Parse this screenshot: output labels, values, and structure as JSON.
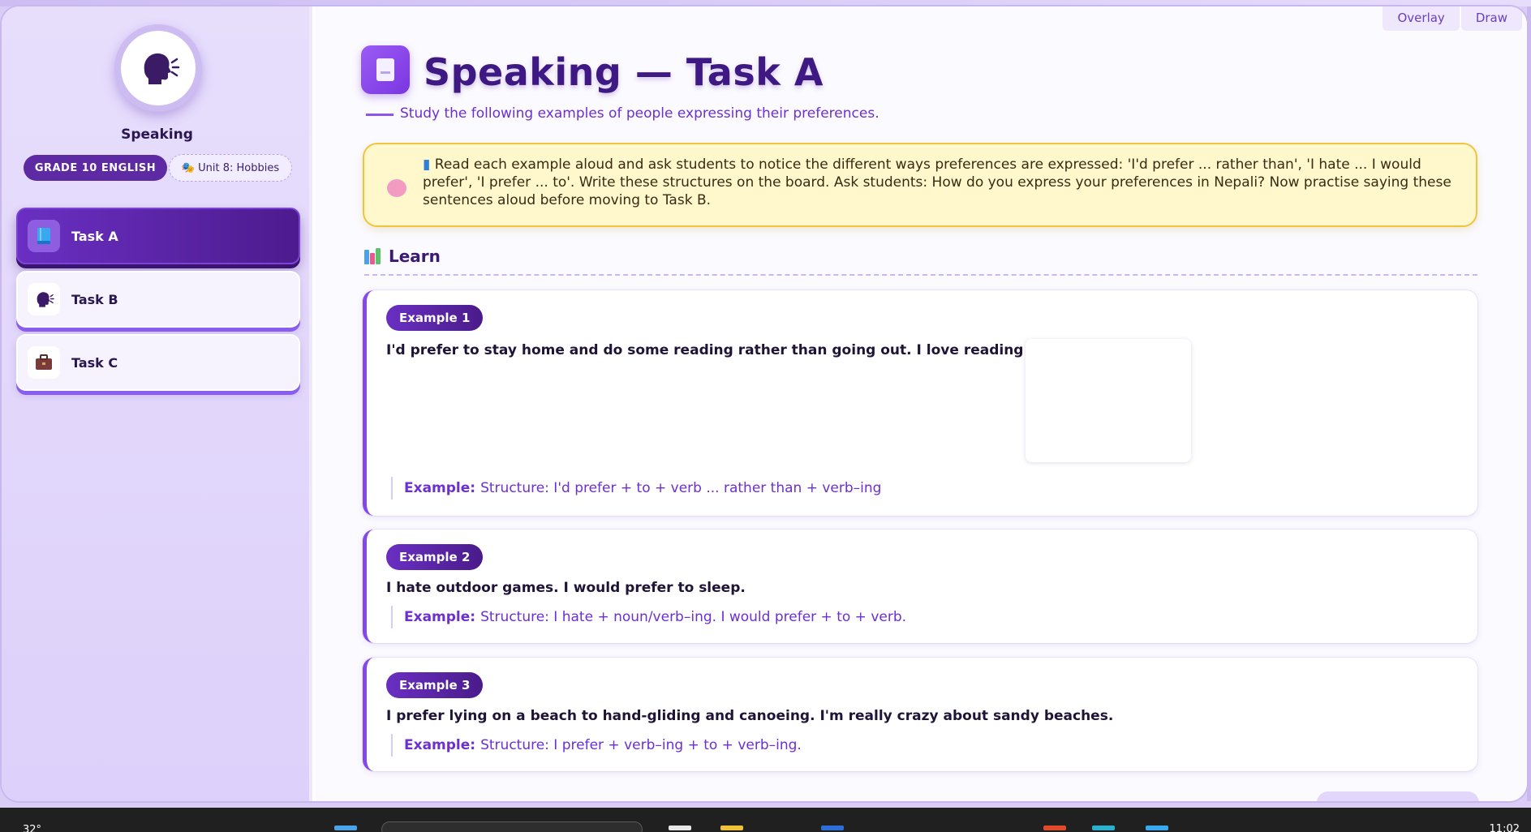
{
  "sidebar": {
    "title": "Speaking",
    "grade_label": "GRADE 10 ENGLISH",
    "unit_label": "Unit 8: Hobbies",
    "unit_icon": "theater-masks-icon",
    "tasks": [
      {
        "label": "Task A",
        "icon": "book-icon",
        "active": true
      },
      {
        "label": "Task B",
        "icon": "speaking-head-icon",
        "active": false
      },
      {
        "label": "Task C",
        "icon": "briefcase-icon",
        "active": false
      }
    ]
  },
  "toolbar": {
    "overlay_label": "Overlay",
    "draw_label": "Draw"
  },
  "header": {
    "title": "Speaking — Task A",
    "subtitle": "Study the following examples of people expressing their preferences."
  },
  "note": {
    "text": "Read each example aloud and ask students to notice the different ways preferences are expressed: 'I'd prefer ... rather than', 'I hate ... I would prefer', 'I prefer ... to'. Write these structures on the board. Ask students: How do you express your preferences in Nepali? Now practise saying these sentences aloud before moving to Task B."
  },
  "learn": {
    "heading": "Learn"
  },
  "examples": [
    {
      "badge": "Example 1",
      "text": "I'd prefer to stay home and do some reading rather than going out. I love reading classics.",
      "example_label": "Example:",
      "structure": "Structure: I'd prefer + to + verb ... rather than + verb–ing"
    },
    {
      "badge": "Example 2",
      "text": "I hate outdoor games. I would prefer to sleep.",
      "example_label": "Example:",
      "structure": "Structure: I hate + noun/verb–ing. I would prefer + to + verb."
    },
    {
      "badge": "Example 3",
      "text": "I prefer lying on a beach to hand-gliding and canoeing. I'm really crazy about sandy beaches.",
      "example_label": "Example:",
      "structure": "Structure: I prefer + verb–ing + to + verb–ing."
    }
  ],
  "taskbar": {
    "temperature": "32°",
    "clock": "11:02"
  },
  "colors": {
    "accent": "#6a2fc2",
    "note_bg": "#fff8cc",
    "note_border": "#f1c43f"
  }
}
